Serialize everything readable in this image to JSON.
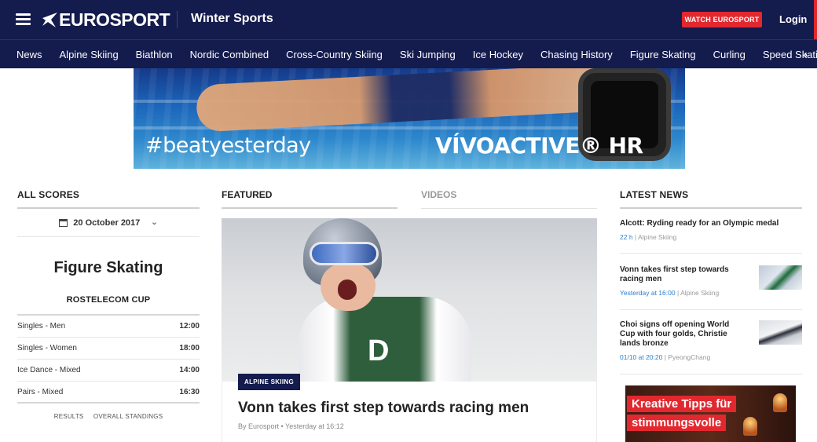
{
  "header": {
    "logo_text": "EUROSPORT",
    "section": "Winter Sports",
    "watch_button": "WATCH EUROSPORT",
    "login": "Login",
    "colors": {
      "navy": "#141b4d",
      "accent_red": "#e2282f",
      "link_blue": "#2a7fd0"
    }
  },
  "nav": {
    "items": [
      "News",
      "Alpine Skiing",
      "Biathlon",
      "Nordic Combined",
      "Cross-Country Skiing",
      "Ski Jumping",
      "Ice Hockey",
      "Chasing History",
      "Figure Skating",
      "Curling",
      "Speed Skating"
    ],
    "more_icon": "chevron-right-icon"
  },
  "ad_banner": {
    "hashtag": "#beatyesterday",
    "product": "VÍVOACTIVE® HR"
  },
  "scores": {
    "heading": "ALL SCORES",
    "date": "20 October 2017",
    "sport": "Figure Skating",
    "event": "ROSTELECOM CUP",
    "rows": [
      {
        "name": "Singles - Men",
        "time": "12:00"
      },
      {
        "name": "Singles - Women",
        "time": "18:00"
      },
      {
        "name": "Ice Dance - Mixed",
        "time": "14:00"
      },
      {
        "name": "Pairs - Mixed",
        "time": "16:30"
      }
    ],
    "links": {
      "results": "RESULTS",
      "standings": "OVERALL STANDINGS"
    }
  },
  "featured": {
    "tab_featured": "FEATURED",
    "tab_videos": "VIDEOS",
    "category": "ALPINE SKIING",
    "headline": "Vonn takes first step towards racing men",
    "byline": "By Eurosport • Yesterday at 16:12",
    "bib_letter": "D"
  },
  "latest_news": {
    "heading": "LATEST NEWS",
    "items": [
      {
        "title": "Alcott: Ryding ready for an Olympic medal",
        "when": "22 h",
        "category": "Alpine Skiing"
      },
      {
        "title": "Vonn takes first step towards racing men",
        "when": "Yesterday at 16:00",
        "category": "Alpine Skiing"
      },
      {
        "title": "Choi signs off opening World Cup with four golds, Christie lands bronze",
        "when": "01/10 at 20:20",
        "category": "PyeongChang"
      }
    ],
    "meta_separator": "|"
  },
  "ad_side": {
    "line1": "Kreative Tipps für",
    "line2": "stimmungsvolle"
  }
}
